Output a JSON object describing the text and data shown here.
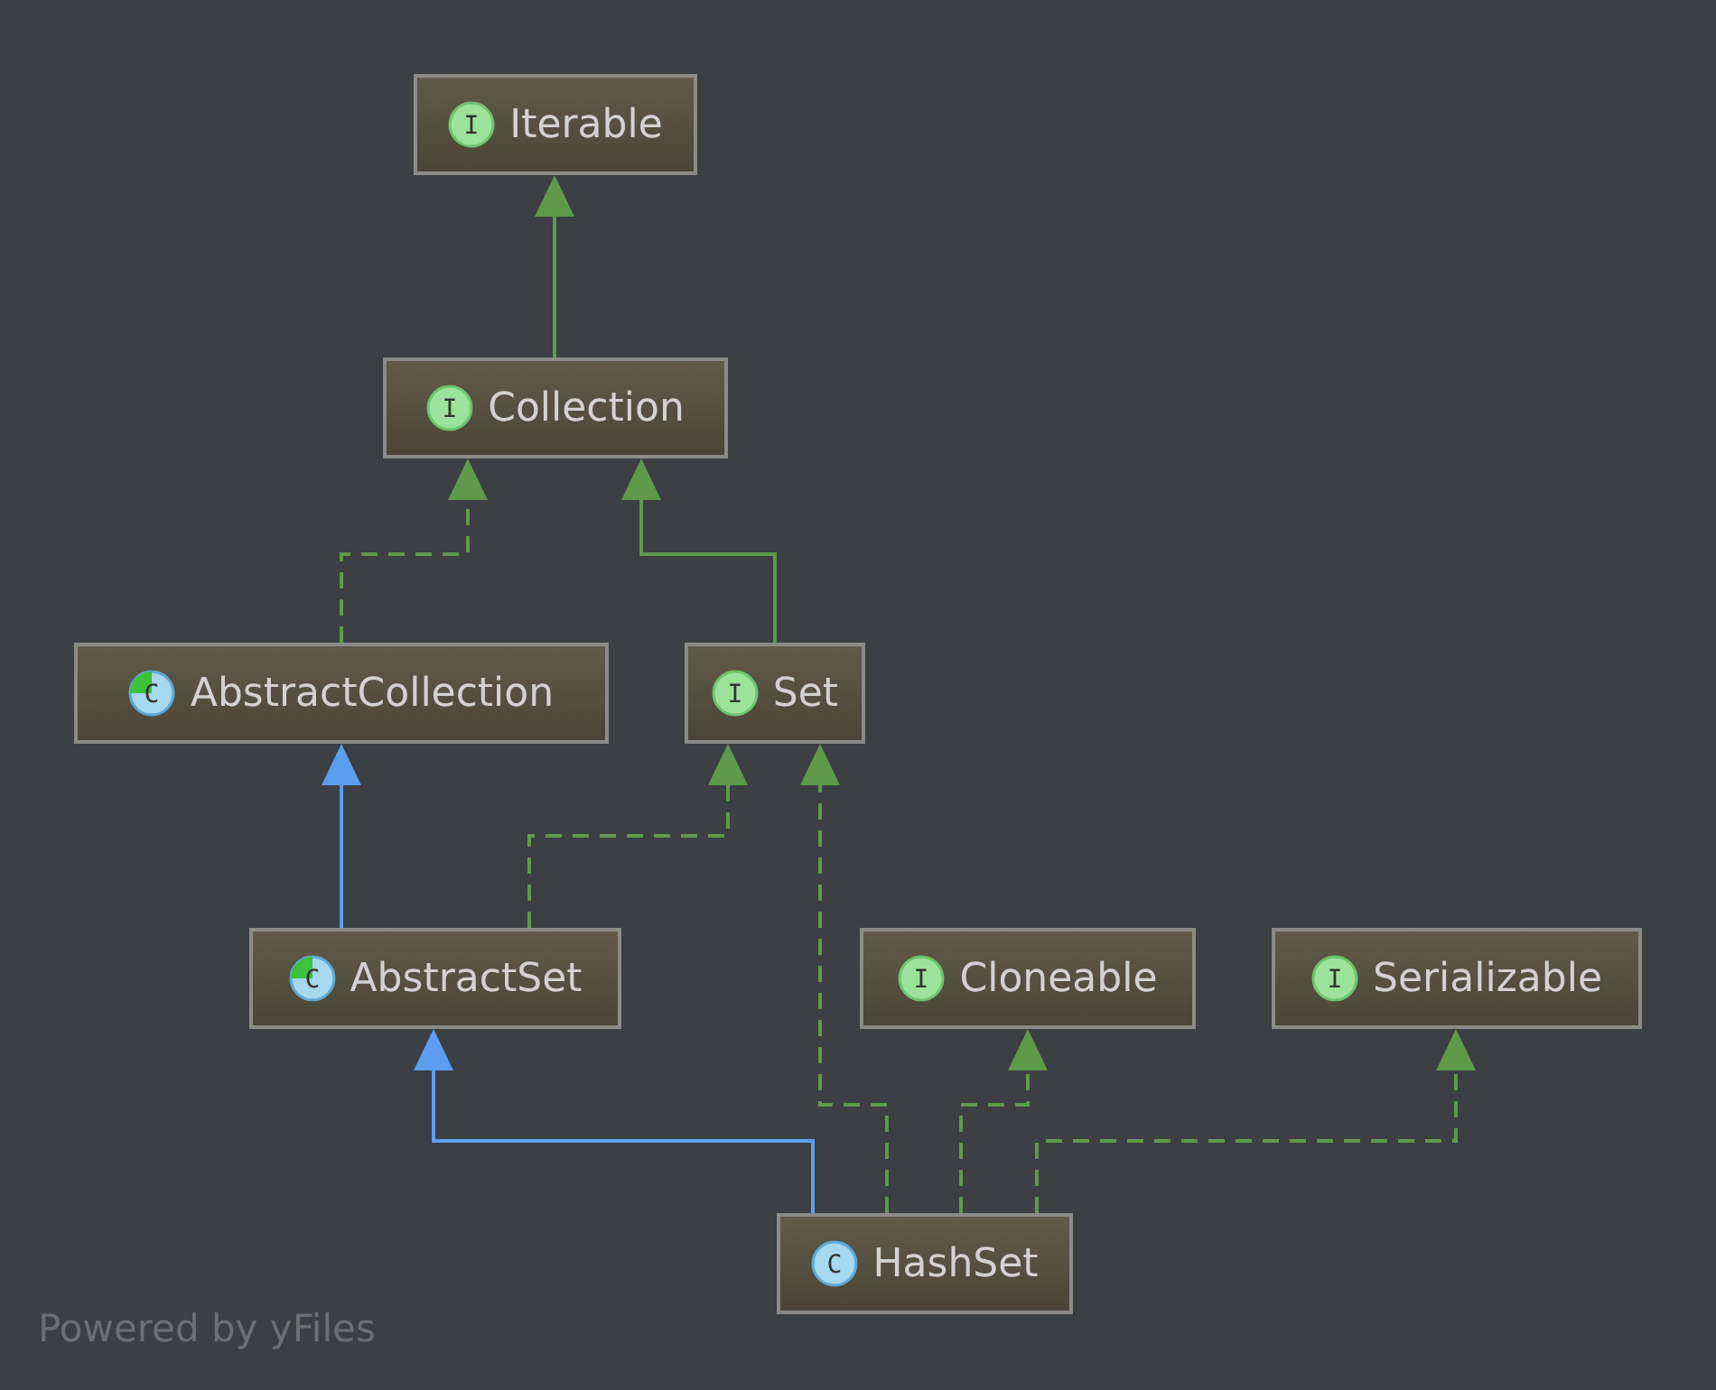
{
  "diagram": {
    "nodes": [
      {
        "name": "Iterable",
        "kind": "interface",
        "badge": "I"
      },
      {
        "name": "Collection",
        "kind": "interface",
        "badge": "I"
      },
      {
        "name": "AbstractCollection",
        "kind": "abstract",
        "badge": "C"
      },
      {
        "name": "Set",
        "kind": "interface",
        "badge": "I"
      },
      {
        "name": "AbstractSet",
        "kind": "abstract",
        "badge": "C"
      },
      {
        "name": "Cloneable",
        "kind": "interface",
        "badge": "I"
      },
      {
        "name": "Serializable",
        "kind": "interface",
        "badge": "I"
      },
      {
        "name": "HashSet",
        "kind": "class",
        "badge": "C"
      }
    ],
    "edges": [
      {
        "kind": "interface-extends"
      },
      {
        "kind": "implements"
      },
      {
        "kind": "interface-extends"
      },
      {
        "kind": "class-extends"
      },
      {
        "kind": "implements"
      },
      {
        "kind": "class-extends"
      },
      {
        "kind": "implements"
      },
      {
        "kind": "implements"
      },
      {
        "kind": "implements"
      }
    ]
  },
  "footer": "Powered by yFiles"
}
